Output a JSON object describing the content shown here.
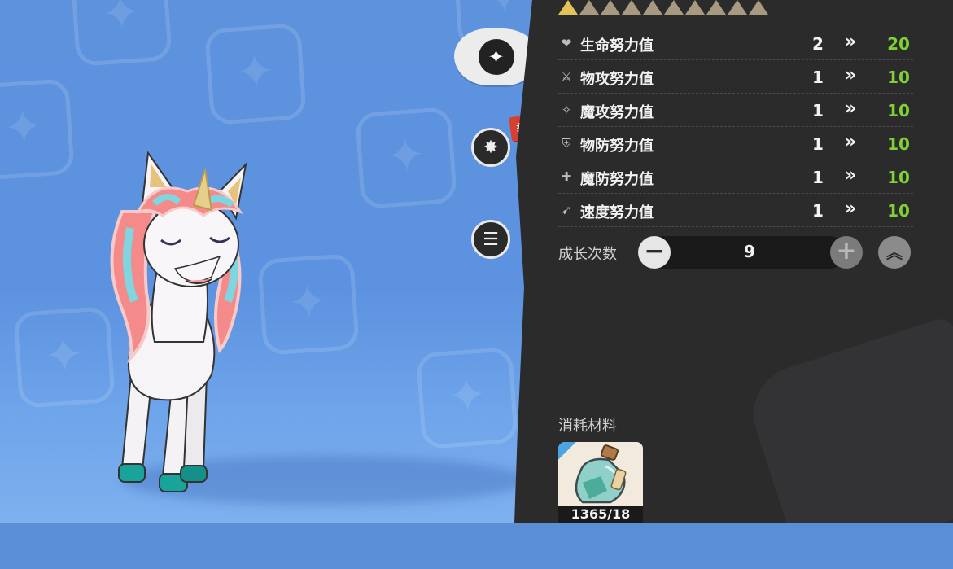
{
  "rank_stars": {
    "filled": 1,
    "total": 10
  },
  "side_menu": {
    "ev_icon": "ev-training-icon",
    "skill_icon": "skill-icon",
    "note_icon": "notes-icon",
    "new_badge": "新"
  },
  "stats": [
    {
      "icon": "heart-icon",
      "label": "生命努力值",
      "current": "2",
      "arrow": "»",
      "next": "20"
    },
    {
      "icon": "sword-icon",
      "label": "物攻努力值",
      "current": "1",
      "arrow": "»",
      "next": "10"
    },
    {
      "icon": "wand-icon",
      "label": "魔攻努力值",
      "current": "1",
      "arrow": "»",
      "next": "10"
    },
    {
      "icon": "shield-icon",
      "label": "物防努力值",
      "current": "1",
      "arrow": "»",
      "next": "10"
    },
    {
      "icon": "magic-shield-icon",
      "label": "魔防努力值",
      "current": "1",
      "arrow": "»",
      "next": "10"
    },
    {
      "icon": "boot-icon",
      "label": "速度努力值",
      "current": "1",
      "arrow": "»",
      "next": "10"
    }
  ],
  "growth": {
    "label": "成长次数",
    "minus": "−",
    "value": "9",
    "plus": "+",
    "max": "︽"
  },
  "materials": {
    "title": "消耗材料",
    "items": [
      {
        "icon": "potion-bottle-icon",
        "count": "1365/18"
      }
    ]
  },
  "colors": {
    "panel_bg": "#2b2b2c",
    "next_value": "#7fd134",
    "star_on": "#e2c259",
    "star_off": "#a89a80",
    "new_badge": "#d6402f"
  }
}
